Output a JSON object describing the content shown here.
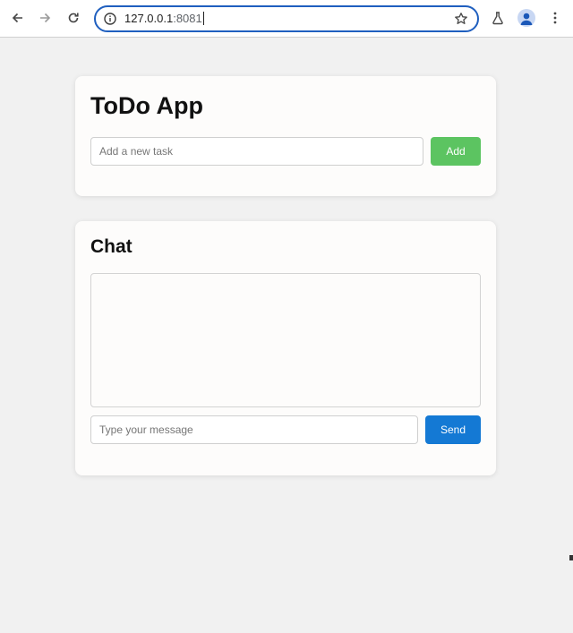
{
  "browser": {
    "url_host": "127.0.0.1",
    "url_port": ":8081",
    "icons": {
      "back": "arrow-left-icon",
      "forward": "arrow-right-icon",
      "reload": "reload-icon",
      "info": "info-icon",
      "bookmark": "star-icon",
      "labs": "flask-icon",
      "profile": "avatar-icon",
      "menu": "kebab-menu-icon"
    }
  },
  "todo": {
    "title": "ToDo App",
    "input_placeholder": "Add a new task",
    "add_label": "Add"
  },
  "chat": {
    "title": "Chat",
    "input_placeholder": "Type your message",
    "send_label": "Send"
  },
  "colors": {
    "add_button": "#5cc461",
    "send_button": "#1479d4",
    "address_focus": "#1f5fbf",
    "page_background": "#f1f1f1"
  }
}
